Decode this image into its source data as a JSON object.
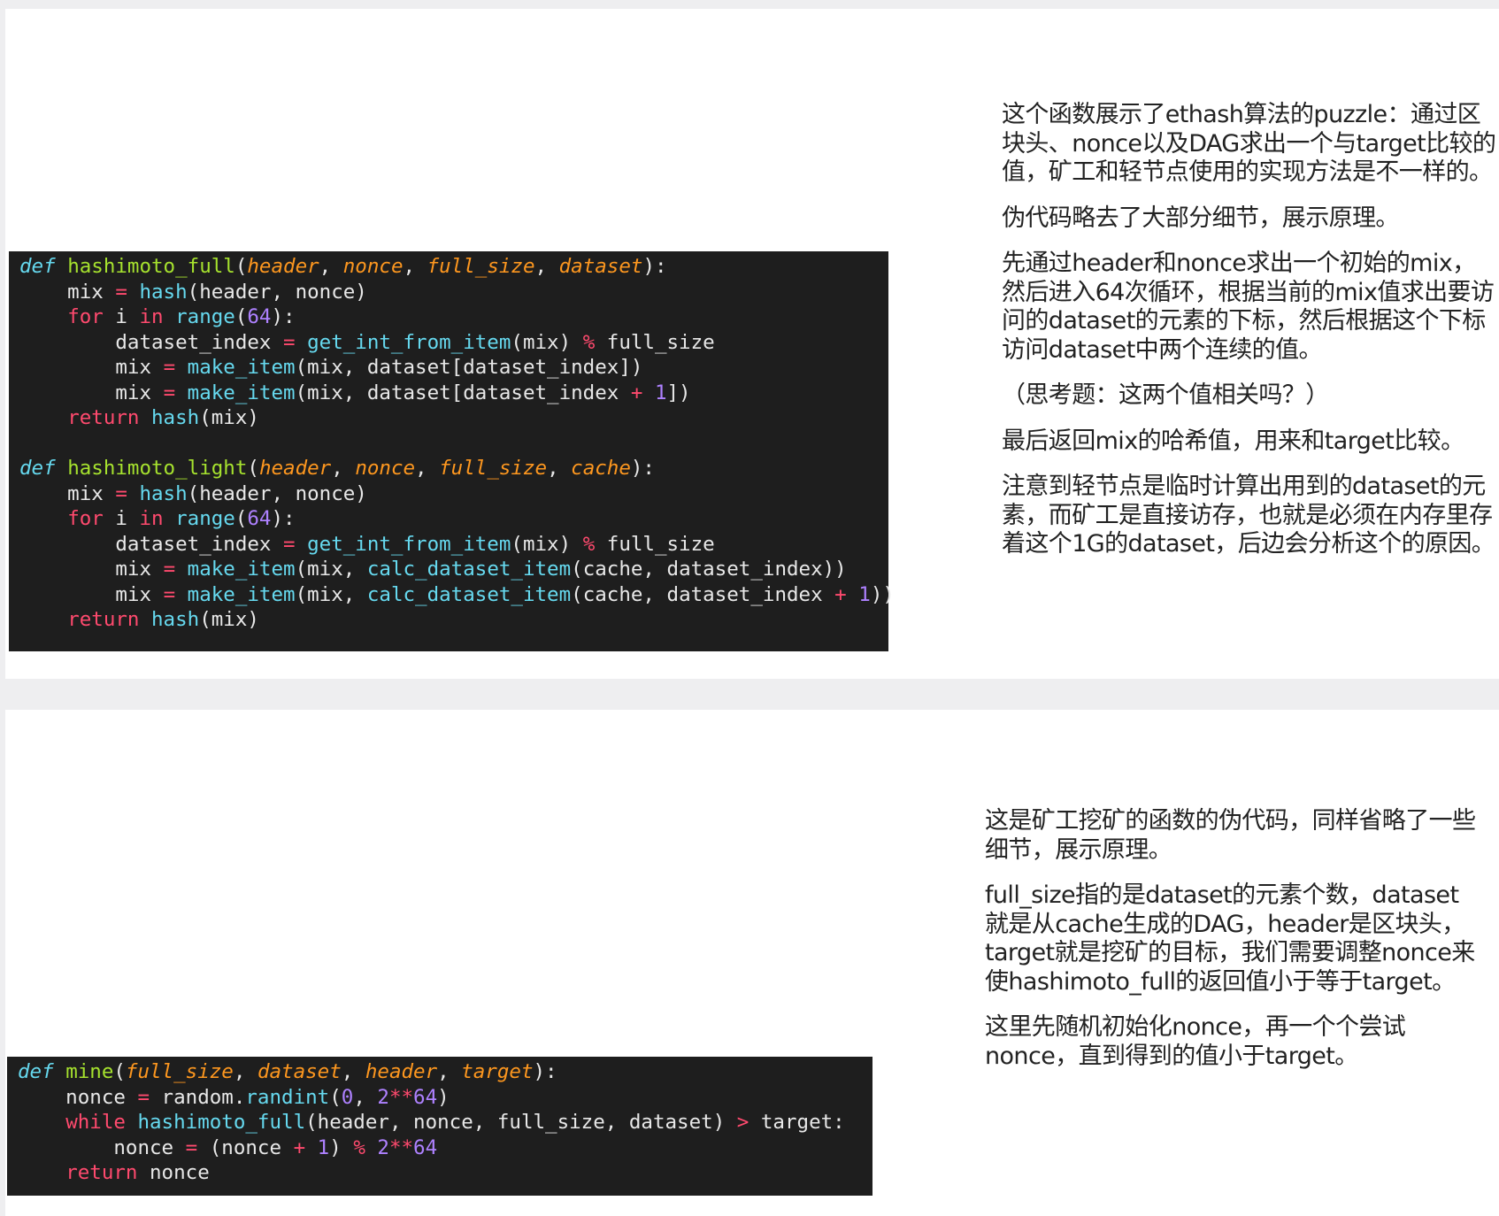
{
  "slides": [
    {
      "code": {
        "lines": [
          [
            {
              "t": "def",
              "c": "df"
            },
            {
              "t": " "
            },
            {
              "t": "hashimoto_full",
              "c": "fn"
            },
            {
              "t": "("
            },
            {
              "t": "header",
              "c": "pa"
            },
            {
              "t": ", "
            },
            {
              "t": "nonce",
              "c": "pa"
            },
            {
              "t": ", "
            },
            {
              "t": "full_size",
              "c": "pa"
            },
            {
              "t": ", "
            },
            {
              "t": "dataset",
              "c": "pa"
            },
            {
              "t": "):"
            }
          ],
          [
            {
              "t": "    mix "
            },
            {
              "t": "=",
              "c": "op"
            },
            {
              "t": " "
            },
            {
              "t": "hash",
              "c": "bi"
            },
            {
              "t": "(header, nonce)"
            }
          ],
          [
            {
              "t": "    "
            },
            {
              "t": "for",
              "c": "kw"
            },
            {
              "t": " i "
            },
            {
              "t": "in",
              "c": "kw"
            },
            {
              "t": " "
            },
            {
              "t": "range",
              "c": "bi"
            },
            {
              "t": "("
            },
            {
              "t": "64",
              "c": "nu"
            },
            {
              "t": "):"
            }
          ],
          [
            {
              "t": "        dataset_index "
            },
            {
              "t": "=",
              "c": "op"
            },
            {
              "t": " "
            },
            {
              "t": "get_int_from_item",
              "c": "bi"
            },
            {
              "t": "(mix) "
            },
            {
              "t": "%",
              "c": "op"
            },
            {
              "t": " full_size"
            }
          ],
          [
            {
              "t": "        mix "
            },
            {
              "t": "=",
              "c": "op"
            },
            {
              "t": " "
            },
            {
              "t": "make_item",
              "c": "bi"
            },
            {
              "t": "(mix, dataset[dataset_index])"
            }
          ],
          [
            {
              "t": "        mix "
            },
            {
              "t": "=",
              "c": "op"
            },
            {
              "t": " "
            },
            {
              "t": "make_item",
              "c": "bi"
            },
            {
              "t": "(mix, dataset[dataset_index "
            },
            {
              "t": "+",
              "c": "op"
            },
            {
              "t": " "
            },
            {
              "t": "1",
              "c": "nu"
            },
            {
              "t": "])"
            }
          ],
          [
            {
              "t": "    "
            },
            {
              "t": "return",
              "c": "kw"
            },
            {
              "t": " "
            },
            {
              "t": "hash",
              "c": "bi"
            },
            {
              "t": "(mix)"
            }
          ],
          [],
          [
            {
              "t": "def",
              "c": "df"
            },
            {
              "t": " "
            },
            {
              "t": "hashimoto_light",
              "c": "fn"
            },
            {
              "t": "("
            },
            {
              "t": "header",
              "c": "pa"
            },
            {
              "t": ", "
            },
            {
              "t": "nonce",
              "c": "pa"
            },
            {
              "t": ", "
            },
            {
              "t": "full_size",
              "c": "pa"
            },
            {
              "t": ", "
            },
            {
              "t": "cache",
              "c": "pa"
            },
            {
              "t": "):"
            }
          ],
          [
            {
              "t": "    mix "
            },
            {
              "t": "=",
              "c": "op"
            },
            {
              "t": " "
            },
            {
              "t": "hash",
              "c": "bi"
            },
            {
              "t": "(header, nonce)"
            }
          ],
          [
            {
              "t": "    "
            },
            {
              "t": "for",
              "c": "kw"
            },
            {
              "t": " i "
            },
            {
              "t": "in",
              "c": "kw"
            },
            {
              "t": " "
            },
            {
              "t": "range",
              "c": "bi"
            },
            {
              "t": "("
            },
            {
              "t": "64",
              "c": "nu"
            },
            {
              "t": "):"
            }
          ],
          [
            {
              "t": "        dataset_index "
            },
            {
              "t": "=",
              "c": "op"
            },
            {
              "t": " "
            },
            {
              "t": "get_int_from_item",
              "c": "bi"
            },
            {
              "t": "(mix) "
            },
            {
              "t": "%",
              "c": "op"
            },
            {
              "t": " full_size"
            }
          ],
          [
            {
              "t": "        mix "
            },
            {
              "t": "=",
              "c": "op"
            },
            {
              "t": " "
            },
            {
              "t": "make_item",
              "c": "bi"
            },
            {
              "t": "(mix, "
            },
            {
              "t": "calc_dataset_item",
              "c": "bi"
            },
            {
              "t": "(cache, dataset_index))"
            }
          ],
          [
            {
              "t": "        mix "
            },
            {
              "t": "=",
              "c": "op"
            },
            {
              "t": " "
            },
            {
              "t": "make_item",
              "c": "bi"
            },
            {
              "t": "(mix, "
            },
            {
              "t": "calc_dataset_item",
              "c": "bi"
            },
            {
              "t": "(cache, dataset_index "
            },
            {
              "t": "+",
              "c": "op"
            },
            {
              "t": " "
            },
            {
              "t": "1",
              "c": "nu"
            },
            {
              "t": "))"
            }
          ],
          [
            {
              "t": "    "
            },
            {
              "t": "return",
              "c": "kw"
            },
            {
              "t": " "
            },
            {
              "t": "hash",
              "c": "bi"
            },
            {
              "t": "(mix)"
            }
          ]
        ]
      },
      "notes": [
        "这个函数展示了ethash算法的puzzle：通过区块头、nonce以及DAG求出一个与target比较的值，矿工和轻节点使用的实现方法是不一样的。",
        "伪代码略去了大部分细节，展示原理。",
        "先通过header和nonce求出一个初始的mix，然后进入64次循环，根据当前的mix值求出要访问的dataset的元素的下标，然后根据这个下标访问dataset中两个连续的值。",
        "（思考题：这两个值相关吗？）",
        "最后返回mix的哈希值，用来和target比较。",
        "注意到轻节点是临时计算出用到的dataset的元素，而矿工是直接访存，也就是必须在内存里存着这个1G的dataset，后边会分析这个的原因。"
      ]
    },
    {
      "code": {
        "lines": [
          [
            {
              "t": "def",
              "c": "df"
            },
            {
              "t": " "
            },
            {
              "t": "mine",
              "c": "fn"
            },
            {
              "t": "("
            },
            {
              "t": "full_size",
              "c": "pa"
            },
            {
              "t": ", "
            },
            {
              "t": "dataset",
              "c": "pa"
            },
            {
              "t": ", "
            },
            {
              "t": "header",
              "c": "pa"
            },
            {
              "t": ", "
            },
            {
              "t": "target",
              "c": "pa"
            },
            {
              "t": "):"
            }
          ],
          [
            {
              "t": "    nonce "
            },
            {
              "t": "=",
              "c": "op"
            },
            {
              "t": " random."
            },
            {
              "t": "randint",
              "c": "bi"
            },
            {
              "t": "("
            },
            {
              "t": "0",
              "c": "nu"
            },
            {
              "t": ", "
            },
            {
              "t": "2",
              "c": "nu"
            },
            {
              "t": "**",
              "c": "op"
            },
            {
              "t": "64",
              "c": "nu"
            },
            {
              "t": ")"
            }
          ],
          [
            {
              "t": "    "
            },
            {
              "t": "while",
              "c": "kw"
            },
            {
              "t": " "
            },
            {
              "t": "hashimoto_full",
              "c": "bi"
            },
            {
              "t": "(header, nonce, full_size, dataset) "
            },
            {
              "t": ">",
              "c": "op"
            },
            {
              "t": " target:"
            }
          ],
          [
            {
              "t": "        nonce "
            },
            {
              "t": "=",
              "c": "op"
            },
            {
              "t": " (nonce "
            },
            {
              "t": "+",
              "c": "op"
            },
            {
              "t": " "
            },
            {
              "t": "1",
              "c": "nu"
            },
            {
              "t": ") "
            },
            {
              "t": "%",
              "c": "op"
            },
            {
              "t": " "
            },
            {
              "t": "2",
              "c": "nu"
            },
            {
              "t": "**",
              "c": "op"
            },
            {
              "t": "64",
              "c": "nu"
            }
          ],
          [
            {
              "t": "    "
            },
            {
              "t": "return",
              "c": "kw"
            },
            {
              "t": " nonce"
            }
          ]
        ]
      },
      "notes": [
        "这是矿工挖矿的函数的伪代码，同样省略了一些细节，展示原理。",
        "full_size指的是dataset的元素个数，dataset就是从cache生成的DAG，header是区块头，target就是挖矿的目标，我们需要调整nonce来使hashimoto_full的返回值小于等于target。",
        "这里先随机初始化nonce，再一个个尝试nonce，直到得到的值小于target。"
      ]
    }
  ]
}
